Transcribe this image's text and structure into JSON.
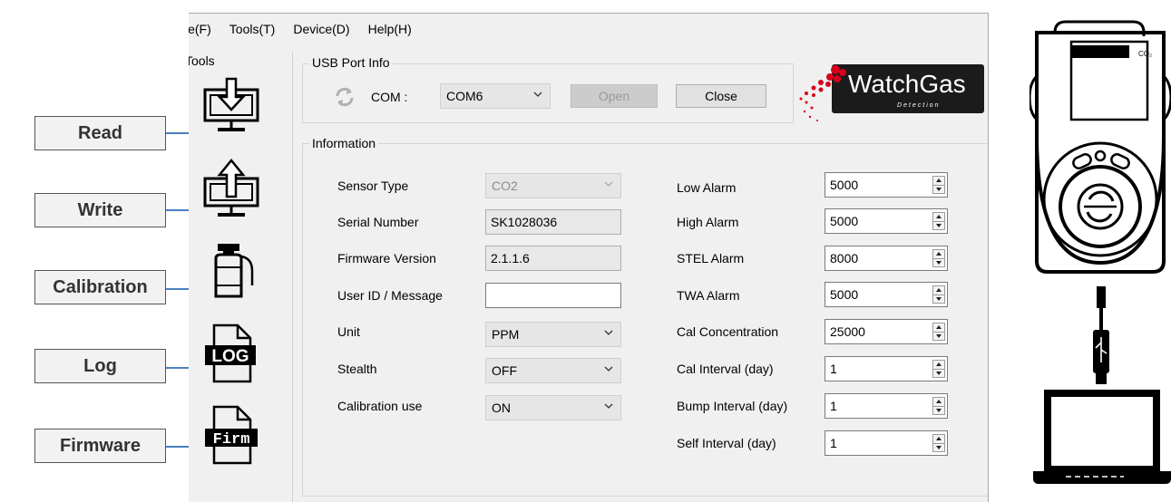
{
  "callouts": [
    "Read",
    "Write",
    "Calibration",
    "Log",
    "Firmware"
  ],
  "menu": [
    "le(F)",
    "Tools(T)",
    "Device(D)",
    "Help(H)"
  ],
  "tools_title": "Tools",
  "usb": {
    "legend": "USB Port Info",
    "com_label": "COM :",
    "com_value": "COM6",
    "open_label": "Open",
    "close_label": "Close"
  },
  "logo": {
    "name": "WatchGas",
    "sub": "Detection"
  },
  "info": {
    "legend": "Information",
    "left": [
      {
        "label": "Sensor Type",
        "value": "CO2"
      },
      {
        "label": "Serial Number",
        "value": "SK1028036"
      },
      {
        "label": "Firmware Version",
        "value": "2.1.1.6"
      },
      {
        "label": "User ID / Message",
        "value": ""
      },
      {
        "label": "Unit",
        "value": "PPM"
      },
      {
        "label": "Stealth",
        "value": "OFF"
      },
      {
        "label": "Calibration use",
        "value": "ON"
      }
    ],
    "right": [
      {
        "label": "Low Alarm",
        "value": "5000"
      },
      {
        "label": "High Alarm",
        "value": "5000"
      },
      {
        "label": "STEL Alarm",
        "value": "8000"
      },
      {
        "label": "TWA Alarm",
        "value": "5000"
      },
      {
        "label": "Cal Concentration",
        "value": "25000"
      },
      {
        "label": "Cal Interval (day)",
        "value": "1"
      },
      {
        "label": "Bump Interval (day)",
        "value": "1"
      },
      {
        "label": "Self Interval (day)",
        "value": "1"
      }
    ]
  },
  "tool_icon_text": {
    "log": "LOG",
    "firm": "Firm"
  },
  "device_label": "CO₂"
}
